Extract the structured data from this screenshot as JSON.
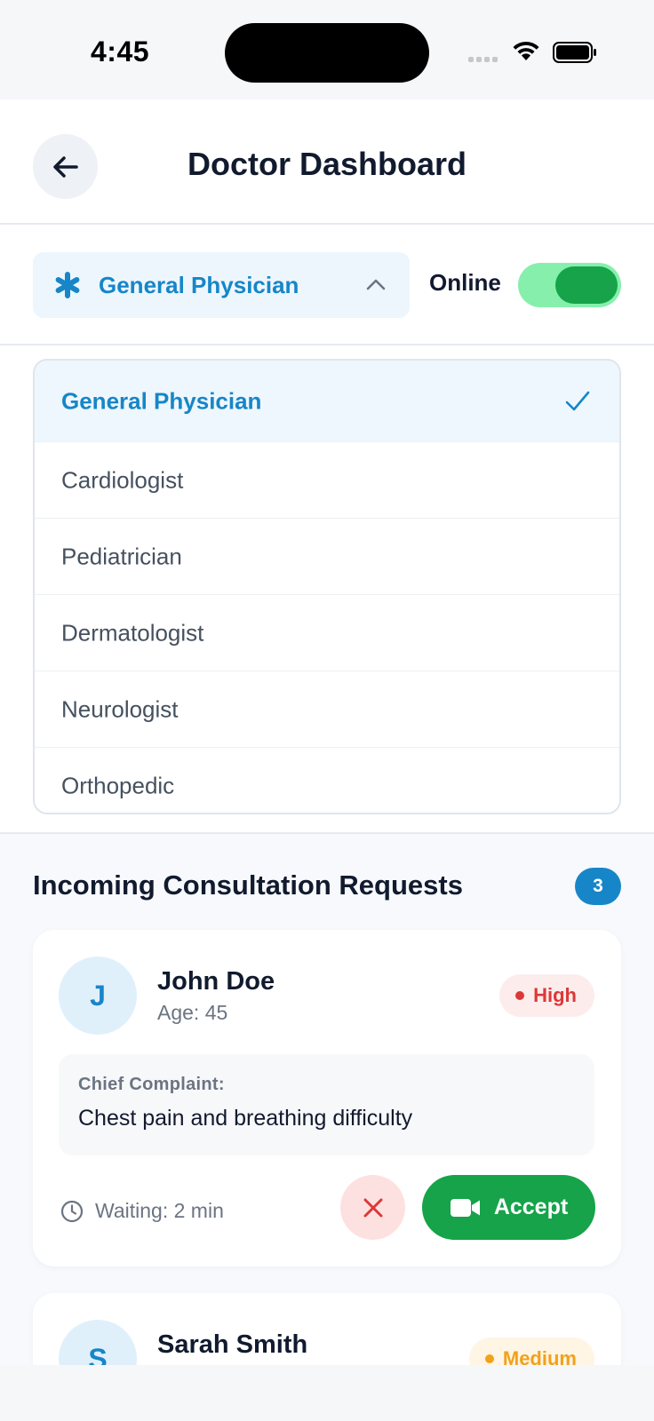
{
  "status_bar": {
    "time": "4:45"
  },
  "header": {
    "title": "Doctor Dashboard"
  },
  "specialty": {
    "selected_label": "General Physician",
    "online_label": "Online",
    "online": true
  },
  "dropdown": {
    "items": [
      {
        "label": "General Physician",
        "selected": true
      },
      {
        "label": "Cardiologist",
        "selected": false
      },
      {
        "label": "Pediatrician",
        "selected": false
      },
      {
        "label": "Dermatologist",
        "selected": false
      },
      {
        "label": "Neurologist",
        "selected": false
      },
      {
        "label": "Orthopedic",
        "selected": false
      }
    ]
  },
  "requests": {
    "title": "Incoming Consultation Requests",
    "count": "3",
    "cards": [
      {
        "initial": "J",
        "name": "John Doe",
        "age": "Age: 45",
        "priority": "High",
        "complaint_label": "Chief Complaint:",
        "complaint": "Chest pain and breathing difficulty",
        "waiting": "Waiting: 2 min",
        "accept_label": "Accept"
      },
      {
        "initial": "S",
        "name": "Sarah Smith",
        "priority": "Medium"
      }
    ]
  },
  "colors": {
    "accent": "#1686c8",
    "success": "#16a34a",
    "danger": "#dc3838",
    "warning": "#f2a11b"
  }
}
